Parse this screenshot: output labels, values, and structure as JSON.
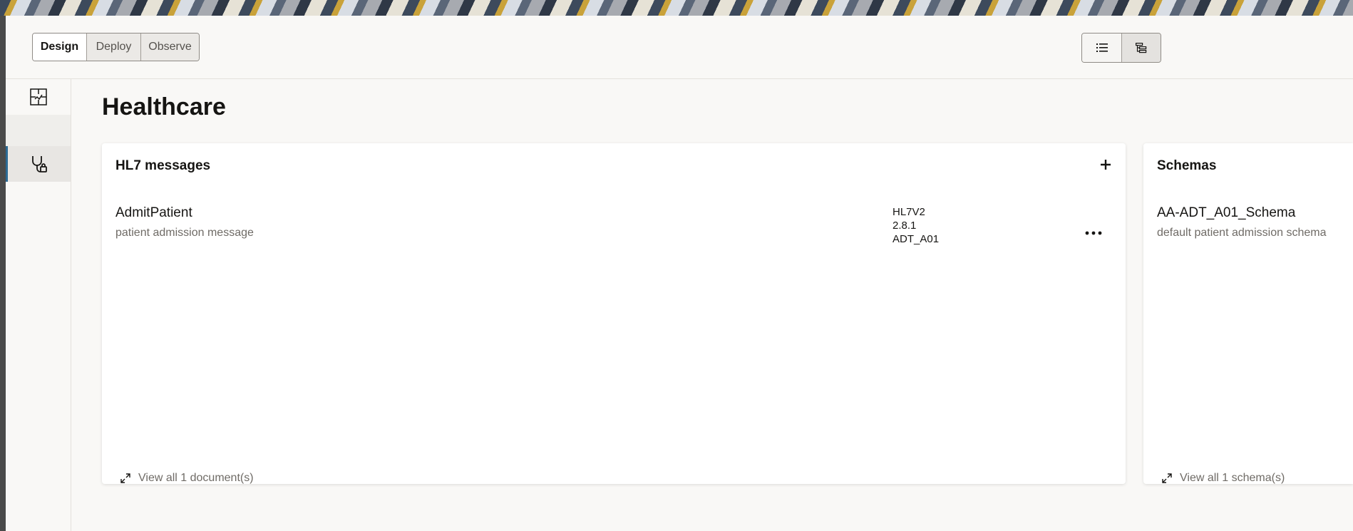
{
  "modes": [
    "Design",
    "Deploy",
    "Observe"
  ],
  "active_mode": "Design",
  "view_toggle": {
    "items": [
      {
        "icon": "list-view-icon",
        "selected": false
      },
      {
        "icon": "tree-view-icon",
        "selected": true
      }
    ]
  },
  "sidebar": {
    "items": [
      {
        "icon": "integrations-icon",
        "active": false
      },
      {
        "icon": "",
        "active": false
      },
      {
        "icon": "stethoscope-icon",
        "active": true
      }
    ]
  },
  "page": {
    "title": "Healthcare"
  },
  "hl7_card": {
    "title": "HL7 messages",
    "items": [
      {
        "name": "AdmitPatient",
        "description": "patient admission message",
        "standard": "HL7V2",
        "version": "2.8.1",
        "message_type": "ADT_A01"
      }
    ],
    "view_all": "View all 1 document(s)"
  },
  "schemas_card": {
    "title": "Schemas",
    "items": [
      {
        "name": "AA-ADT_A01_Schema",
        "description": "default patient admission schema"
      }
    ],
    "view_all": "View all 1 schema(s)"
  },
  "colors": {
    "accent": "#2c6a94",
    "background": "#f9f8f6",
    "muted_text": "#6f6b66"
  }
}
